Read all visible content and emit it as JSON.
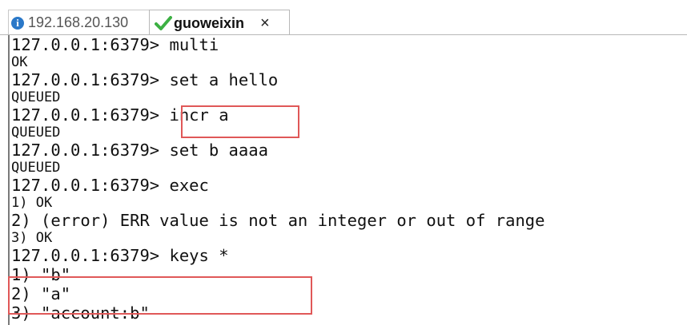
{
  "tabs": [
    {
      "label": "192.168.20.130",
      "icon": "info-icon",
      "active": false
    },
    {
      "label": "guoweixin",
      "icon": "check-icon",
      "active": true,
      "close": "×"
    }
  ],
  "terminal": {
    "prompt": "127.0.0.1:6379> ",
    "lines": [
      {
        "type": "prompt",
        "command": "multi"
      },
      {
        "type": "response",
        "text": "OK"
      },
      {
        "type": "prompt",
        "command": "set a hello"
      },
      {
        "type": "response",
        "text": "QUEUED"
      },
      {
        "type": "prompt",
        "command": "incr a"
      },
      {
        "type": "response",
        "text": "QUEUED"
      },
      {
        "type": "prompt",
        "command": "set b aaaa"
      },
      {
        "type": "response",
        "text": "QUEUED"
      },
      {
        "type": "prompt",
        "command": "exec"
      },
      {
        "type": "response",
        "text": "1) OK"
      },
      {
        "type": "prompt-like",
        "text": "2) (error) ERR value is not an integer or out of range"
      },
      {
        "type": "response",
        "text": "3) OK"
      },
      {
        "type": "prompt",
        "command": "keys *"
      },
      {
        "type": "prompt-like",
        "text": "1) \"b\""
      },
      {
        "type": "prompt-like",
        "text": "2) \"a\""
      },
      {
        "type": "prompt-like",
        "text": "3) \"account:b\""
      }
    ]
  },
  "colors": {
    "highlight": "#e05858",
    "info_icon": "#2a78c8",
    "check_icon": "#3cb043"
  }
}
